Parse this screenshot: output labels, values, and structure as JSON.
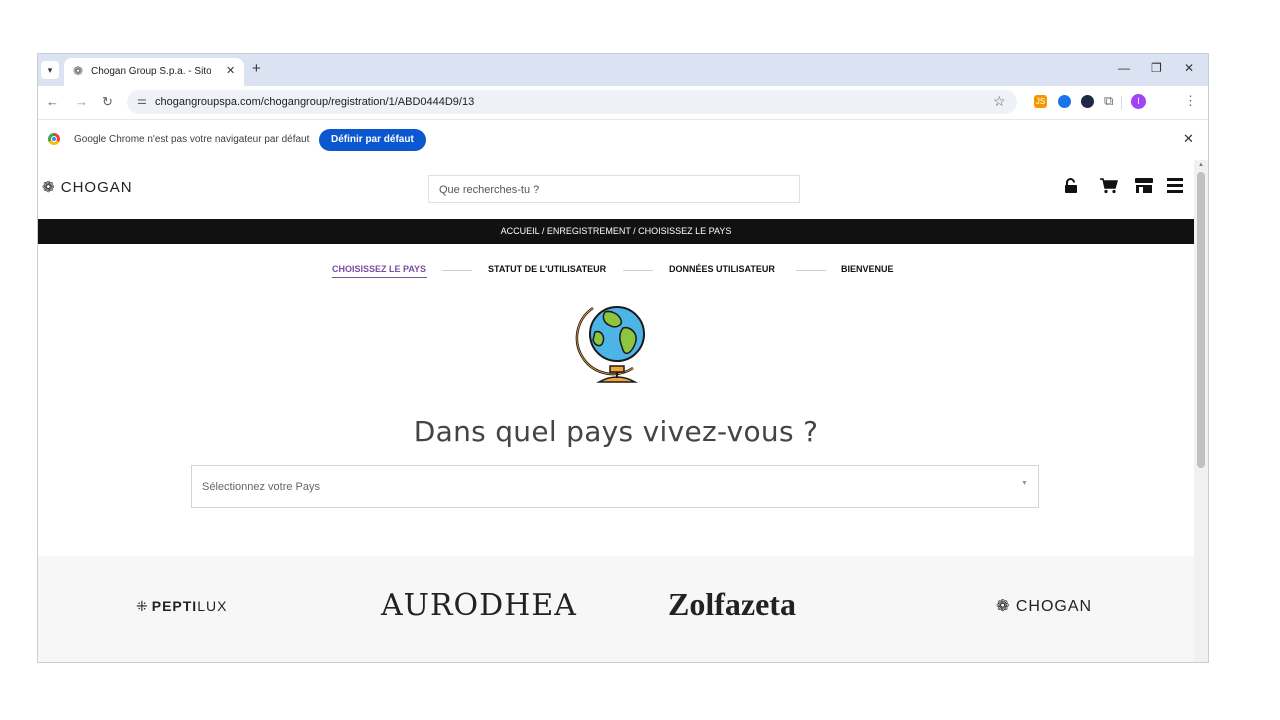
{
  "browser": {
    "tab_title": "Chogan Group S.p.a. - Sito uffic",
    "url": "chogangroupspa.com/chogangroup/registration/1/ABD0444D9/13",
    "profile_initial": "I",
    "ext_js_label": "JS",
    "icons": {
      "tab_menu": "chevron-down-icon",
      "favicon": "chogan-flower-icon",
      "tab_close": "close-icon",
      "new_tab": "plus-icon",
      "minimize": "minimize-icon",
      "restore": "restore-icon",
      "window_close": "close-icon",
      "back": "arrow-left-icon",
      "forward": "arrow-right-icon",
      "reload": "reload-icon",
      "site_info": "tune-icon",
      "bookmark": "star-icon",
      "extensions": "puzzle-icon",
      "menu": "kebab-icon"
    },
    "glyphs": {
      "tab_menu": "▾",
      "favicon": "❁",
      "tab_close": "✕",
      "new_tab": "+",
      "minimize": "—",
      "restore": "❐",
      "window_close": "✕",
      "back": "←",
      "forward": "→",
      "reload": "↻",
      "site_info": "⚌",
      "bookmark": "☆",
      "extensions": "⧉",
      "kebab": "⋮",
      "info_close": "✕"
    }
  },
  "infobar": {
    "message": "Google Chrome n'est pas votre navigateur par défaut",
    "button_label": "Définir par défaut"
  },
  "site": {
    "logo_text": "CHOGAN",
    "logo_glyph": "❁",
    "search_placeholder": "Que recherches-tu ?",
    "header_icons": [
      "lock-open-icon",
      "cart-icon",
      "store-icon",
      "menu-icon"
    ],
    "breadcrumb": "ACCUEIL  /  ENREGISTREMENT  /  CHOISISSEZ LE PAYS",
    "steps": [
      {
        "label": "CHOISISSEZ LE PAYS",
        "active": true
      },
      {
        "label": "STATUT DE L'UTILISATEUR",
        "active": false
      },
      {
        "label": "DONNÉES UTILISATEUR",
        "active": false
      },
      {
        "label": "BIENVENUE",
        "active": false
      }
    ],
    "question": "Dans quel pays vivez-vous ?",
    "country_select": {
      "placeholder": "Sélectionnez votre Pays",
      "caret": "▼"
    },
    "brands": [
      {
        "name": "PEPTILUX",
        "prefix": "PEPTI",
        "suffix": "LUX"
      },
      {
        "name": "AURODHEA"
      },
      {
        "name": "Zolfazeta"
      },
      {
        "name": "CHOGAN"
      }
    ],
    "accent_color": "#7b4fa0"
  }
}
